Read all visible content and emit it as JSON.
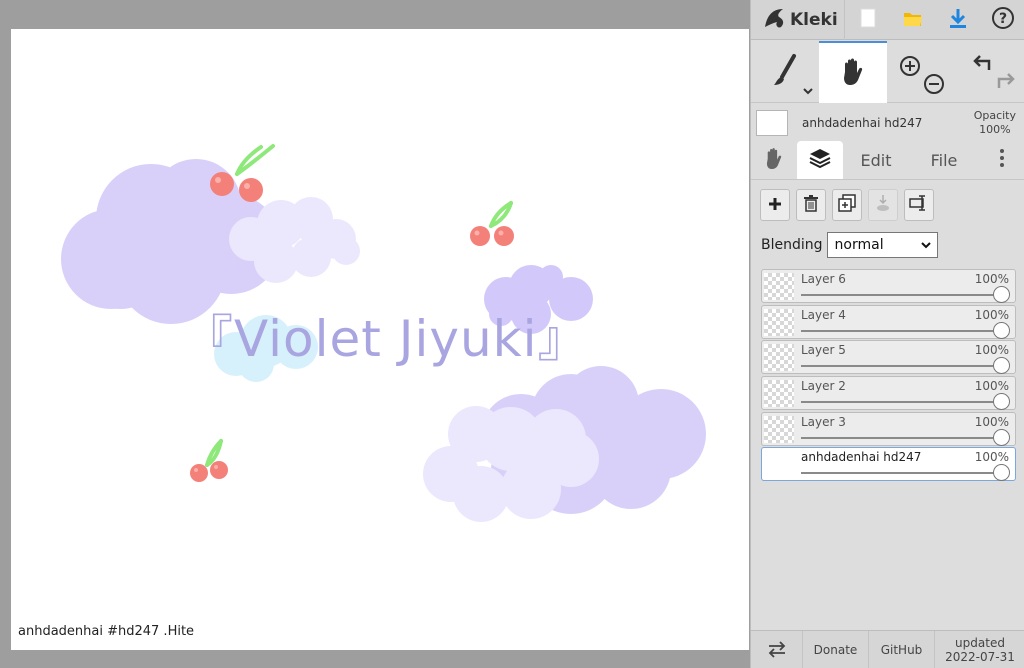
{
  "app": {
    "name": "Kleki"
  },
  "canvas": {
    "title_text": "『Violet Jiyuki』",
    "signature": "anhdadenhai #hd247 .Hite"
  },
  "layer_preview": {
    "name": "anhdadenhai hd247",
    "opacity_label": "Opacity",
    "opacity_value": "100%"
  },
  "tabs": {
    "edit": "Edit",
    "file": "File"
  },
  "blending": {
    "label": "Blending",
    "value": "normal"
  },
  "layers": [
    {
      "name": "Layer 6",
      "opacity": "100%"
    },
    {
      "name": "Layer 4",
      "opacity": "100%"
    },
    {
      "name": "Layer 5",
      "opacity": "100%"
    },
    {
      "name": "Layer 2",
      "opacity": "100%"
    },
    {
      "name": "Layer 3",
      "opacity": "100%"
    },
    {
      "name": "anhdadenhai hd247",
      "opacity": "100%"
    }
  ],
  "footer": {
    "donate": "Donate",
    "github": "GitHub",
    "updated_label": "updated",
    "updated_date": "2022-07-31"
  },
  "colors": {
    "accent": "#4a8fd6",
    "cloud_purple": "#d9d0fa",
    "cloud_light": "#ebe8fd",
    "cloud_blue": "#d6f1fb",
    "cherry": "#f4807a",
    "stem": "#8ee87a",
    "title_text": "#a9a5e0"
  },
  "icons": [
    "kleki-logo-icon",
    "new-image-icon",
    "open-folder-icon",
    "download-icon",
    "help-icon",
    "brush-icon",
    "hand-icon",
    "zoom-in-icon",
    "zoom-out-icon",
    "undo-icon",
    "redo-icon",
    "add-layer-icon",
    "delete-layer-icon",
    "duplicate-layer-icon",
    "merge-layer-icon",
    "rename-layer-icon",
    "swap-icon"
  ]
}
